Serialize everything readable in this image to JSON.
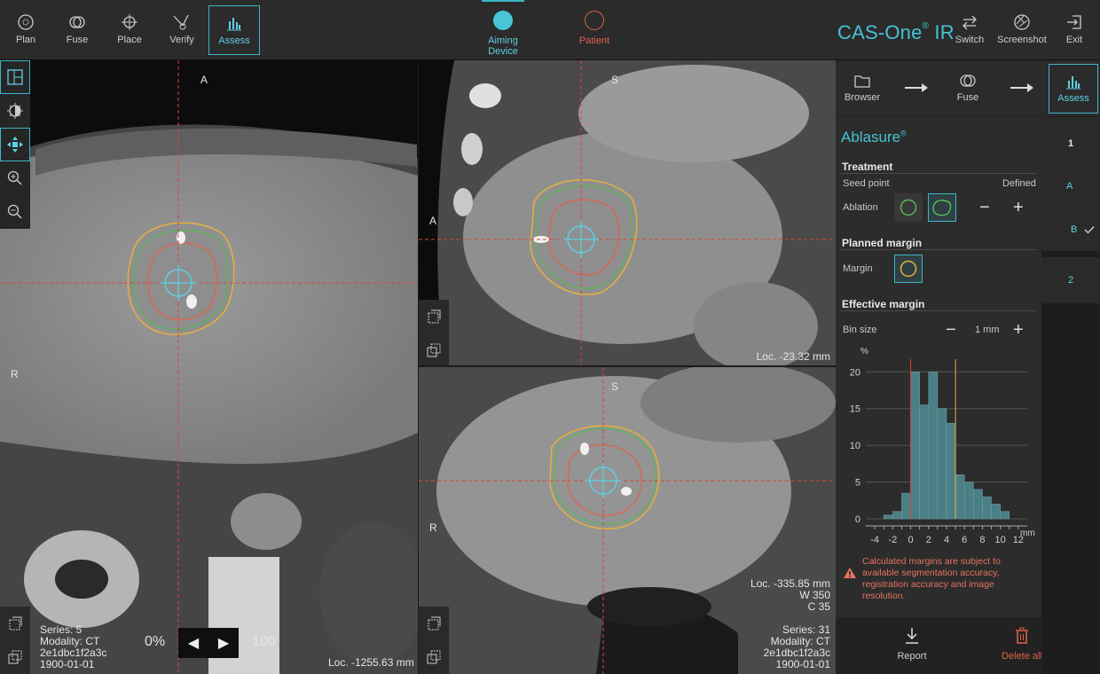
{
  "toolbar": {
    "tools": [
      {
        "label": "Plan",
        "icon": "plan-icon"
      },
      {
        "label": "Fuse",
        "icon": "fuse-icon"
      },
      {
        "label": "Place",
        "icon": "place-icon"
      },
      {
        "label": "Verify",
        "icon": "verify-icon"
      },
      {
        "label": "Assess",
        "icon": "assess-icon",
        "active": true
      }
    ],
    "aiming_device_label": "Aiming Device",
    "patient_label": "Patient",
    "brand": "CAS-One",
    "brand_sup": "®",
    "brand_suffix": " IR",
    "switch_label": "Switch",
    "screenshot_label": "Screenshot",
    "exit_label": "Exit"
  },
  "viewports": {
    "axial": {
      "orient_top": "A",
      "orient_left": "R",
      "series": "Series: 5",
      "modality": "Modality: CT",
      "id": "2e1dbc1f2a3c",
      "date": "1900-01-01",
      "loc": "Loc. -1255.63 mm",
      "progress_start": "0%",
      "progress_end": "100"
    },
    "sagittal": {
      "orient_top": "S",
      "orient_left": "A",
      "loc": "Loc. -23.32 mm"
    },
    "coronal": {
      "orient_top": "S",
      "orient_left": "R",
      "loc": "Loc. -335.85 mm",
      "window": "W 350",
      "center": "C 35",
      "series": "Series: 31",
      "modality": "Modality: CT",
      "id": "2e1dbc1f2a3c",
      "date": "1900-01-01"
    }
  },
  "steps": {
    "browser": "Browser",
    "fuse": "Fuse",
    "assess": "Assess"
  },
  "panel": {
    "title": "Ablasure",
    "title_sup": "®",
    "treatment_title": "Treatment",
    "seed_point_label": "Seed point",
    "seed_point_value": "Defined",
    "ablation_label": "Ablation",
    "planned_margin_title": "Planned margin",
    "margin_label": "Margin",
    "effective_margin_title": "Effective margin",
    "bin_size_label": "Bin size",
    "bin_size_value": "1 mm",
    "warning": "Calculated margins are subject to available segmentation accuracy, registration accuracy and image resolution.",
    "report_label": "Report",
    "delete_all_label": "Delete all"
  },
  "tabs": {
    "t1": "1",
    "tA": "A",
    "tB": "B",
    "t2": "2"
  },
  "colors": {
    "accent": "#3cb7c9",
    "patient": "#e0624a",
    "hist_bar": "#4a7f86",
    "red_line": "#d9443a",
    "yellow_line": "#e3b23c"
  },
  "chart_data": {
    "type": "bar",
    "title": "",
    "xlabel": "mm",
    "ylabel": "%",
    "x": [
      -2.5,
      -1.5,
      -0.5,
      0.5,
      1.5,
      2.5,
      3.5,
      4.5,
      5.5,
      6.5,
      7.5,
      8.5,
      9.5,
      10.5
    ],
    "values": [
      0.5,
      1,
      3.5,
      20,
      15.5,
      20,
      15,
      13,
      6,
      5,
      4,
      3,
      2,
      1
    ],
    "xticks": [
      -4,
      -2,
      0,
      2,
      4,
      6,
      8,
      10,
      12
    ],
    "yticks": [
      0,
      5,
      10,
      15,
      20
    ],
    "xlim": [
      -5,
      13
    ],
    "ylim": [
      0,
      21
    ],
    "markers": [
      {
        "x": 0,
        "color": "red"
      },
      {
        "x": 5,
        "color": "yellow"
      }
    ]
  }
}
